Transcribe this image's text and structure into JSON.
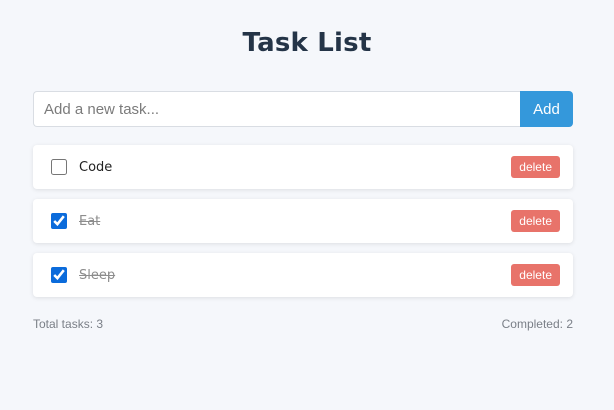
{
  "app": {
    "title": "Task List"
  },
  "input": {
    "placeholder": "Add a new task...",
    "value": "",
    "add_label": "Add"
  },
  "tasks": [
    {
      "text": "Code",
      "completed": false,
      "delete_label": "delete"
    },
    {
      "text": "Eat",
      "completed": true,
      "delete_label": "delete"
    },
    {
      "text": "Sleep",
      "completed": true,
      "delete_label": "delete"
    }
  ],
  "footer": {
    "total_label": "Total tasks: 3",
    "completed_label": "Completed: 2"
  },
  "colors": {
    "accent": "#3498db",
    "delete": "#e8736a",
    "title": "#243447",
    "background": "#f5f7fb"
  }
}
